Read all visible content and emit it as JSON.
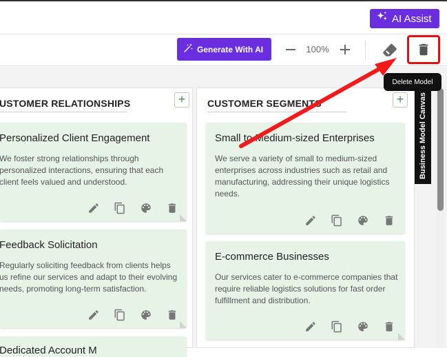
{
  "header": {
    "ai_assist_label": "AI Assist"
  },
  "toolbar": {
    "generate_label": "Generate With AI",
    "zoom": "100%",
    "tooltip": "Delete Model"
  },
  "side_label": "Business Model Canvas",
  "columns": [
    {
      "title": "USTOMER RELATIONSHIPS",
      "cards": [
        {
          "title": "Personalized Client Engagement",
          "desc": "We foster strong relationships through personalized interactions, ensuring that each client feels valued and understood."
        },
        {
          "title": "Feedback Solicitation",
          "desc": "Regularly soliciting feedback from clients helps us refine our services and adapt to their evolving needs, promoting long-term satisfaction."
        },
        {
          "title": "Dedicated Account M",
          "desc": ""
        }
      ]
    },
    {
      "title": "CUSTOMER SEGMENTS",
      "cards": [
        {
          "title": "Small to Medium-sized Enterprises",
          "desc": "We serve a variety of small to medium-sized enterprises across industries such as retail and manufacturing, addressing their unique logistics needs."
        },
        {
          "title": "E-commerce Businesses",
          "desc": "Our services cater to e-commerce companies that require reliable logistics solutions for fast order fulfillment and distribution."
        }
      ]
    }
  ],
  "colors": {
    "accent": "#6a2ee0",
    "card_bg": "#e6f3e6",
    "highlight": "#e01010"
  }
}
